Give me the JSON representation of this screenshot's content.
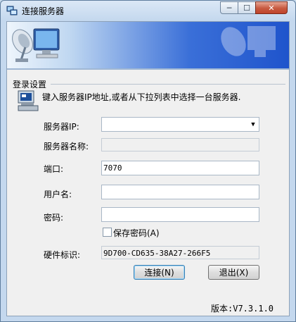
{
  "window": {
    "title": "连接服务器",
    "icon": "computer-network-icon",
    "controls": {
      "minimize": "─",
      "maximize": "☐",
      "close": "✕"
    }
  },
  "group": {
    "label": "登录设置"
  },
  "hint": "键入服务器IP地址,或者从下拉列表中选择一台服务器.",
  "fields": {
    "server_ip": {
      "label": "服务器IP:",
      "value": ""
    },
    "server_name": {
      "label": "服务器名称:",
      "value": ""
    },
    "port": {
      "label": "端口:",
      "value": "7070"
    },
    "username": {
      "label": "用户名:",
      "value": ""
    },
    "password": {
      "label": "密码:",
      "value": ""
    },
    "hardware_id": {
      "label": "硬件标识:",
      "value": "9D700-CD635-38A27-266F5"
    }
  },
  "save_password": {
    "label": "保存密码(A)",
    "checked": false
  },
  "buttons": {
    "connect": "连接(N)",
    "exit": "退出(X)"
  },
  "version": "版本:V7.3.1.0",
  "colors": {
    "banner_blue": "#1f54cc",
    "window_frame": "#c4d8ee",
    "close_red": "#c75a40"
  }
}
